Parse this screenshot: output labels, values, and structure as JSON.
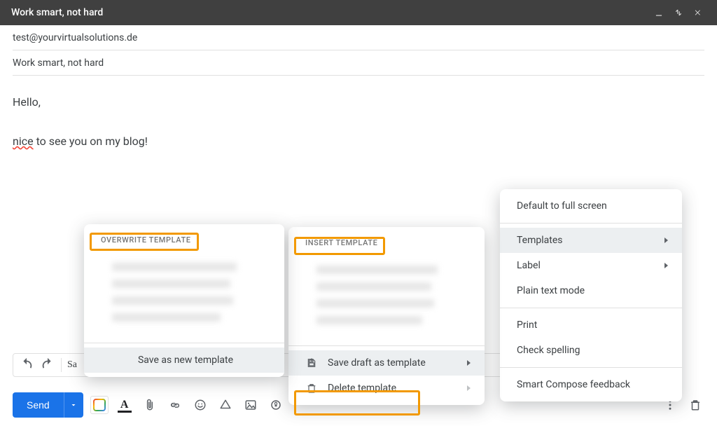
{
  "window": {
    "title": "Work smart, not hard"
  },
  "fields": {
    "to": "test@yourvirtualsolutions.de",
    "subject": "Work smart, not hard"
  },
  "body": {
    "greeting": "Hello,",
    "line1_prefix": "nice",
    "line1_rest": " to see you on my blog!"
  },
  "sub_toolbar": {
    "font_preview": "Sa"
  },
  "toolbar": {
    "send_label": "Send"
  },
  "menu_options": {
    "default_full_screen": "Default to full screen",
    "templates": "Templates",
    "label": "Label",
    "plain_text": "Plain text mode",
    "print": "Print",
    "check_spelling": "Check spelling",
    "smart_compose_feedback": "Smart Compose feedback"
  },
  "menu_insert": {
    "header": "INSERT TEMPLATE",
    "save_draft": "Save draft as template",
    "delete_template": "Delete template"
  },
  "menu_overwrite": {
    "header": "OVERWRITE TEMPLATE",
    "save_new": "Save as new template"
  }
}
